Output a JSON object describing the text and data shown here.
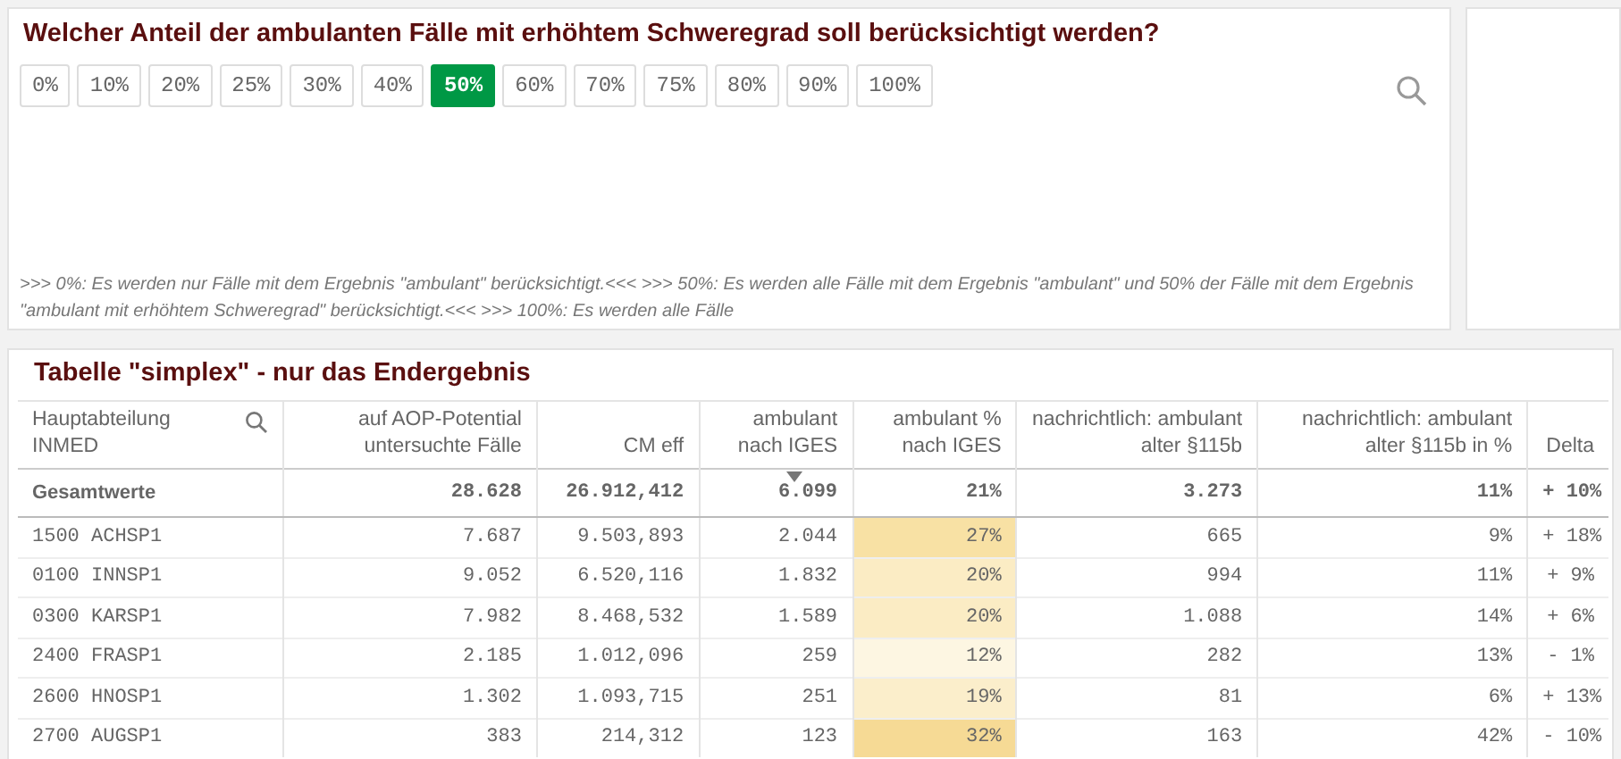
{
  "filter": {
    "title": "Welcher Anteil der ambulanten Fälle mit erhöhtem Schweregrad soll berücksichtigt werden?",
    "options": [
      {
        "label": "0%",
        "selected": false
      },
      {
        "label": "10%",
        "selected": false
      },
      {
        "label": "20%",
        "selected": false
      },
      {
        "label": "25%",
        "selected": false
      },
      {
        "label": "30%",
        "selected": false
      },
      {
        "label": "40%",
        "selected": false
      },
      {
        "label": "50%",
        "selected": true
      },
      {
        "label": "60%",
        "selected": false
      },
      {
        "label": "70%",
        "selected": false
      },
      {
        "label": "75%",
        "selected": false
      },
      {
        "label": "80%",
        "selected": false
      },
      {
        "label": "90%",
        "selected": false
      },
      {
        "label": "100%",
        "selected": false
      }
    ],
    "note": ">>> 0%: Es werden nur Fälle mit dem Ergebnis \"ambulant\" berücksichtigt.<<< >>> 50%: Es werden alle Fälle mit dem Ergebnis \"ambulant\" und 50% der Fälle mit dem Ergebnis \"ambulant mit erhöhtem Schweregrad\" berücksichtigt.<<< >>> 100%: Es werden alle Fälle"
  },
  "table": {
    "title": "Tabelle \"simplex\" - nur das Endergebnis",
    "columns": [
      "Hauptabteilung INMED",
      "auf AOP-Potential untersuchte Fälle",
      "CM eff",
      "ambulant nach IGES",
      "ambulant % nach IGES",
      "nachrichtlich: ambulant alter §115b",
      "nachrichtlich: ambulant alter §115b in %",
      "Delta"
    ],
    "totals": [
      "Gesamtwerte",
      "28.628",
      "26.912,412",
      "6.099",
      "21%",
      "3.273",
      "11%",
      "+ 10%"
    ],
    "rows": [
      {
        "cells": [
          "1500 ACHSP1",
          "7.687",
          "9.503,893",
          "2.044",
          "27%",
          "665",
          "9%",
          "+ 18%"
        ],
        "color": "#f8e1a4"
      },
      {
        "cells": [
          "0100 INNSP1",
          "9.052",
          "6.520,116",
          "1.832",
          "20%",
          "994",
          "11%",
          "+ 9%"
        ],
        "color": "#fbecc4"
      },
      {
        "cells": [
          "0300 KARSP1",
          "7.982",
          "8.468,532",
          "1.589",
          "20%",
          "1.088",
          "14%",
          "+ 6%"
        ],
        "color": "#fbecc4"
      },
      {
        "cells": [
          "2400 FRASP1",
          "2.185",
          "1.012,096",
          "259",
          "12%",
          "282",
          "13%",
          "- 1%"
        ],
        "color": "#fdf6e2"
      },
      {
        "cells": [
          "2600 HNOSP1",
          "1.302",
          "1.093,715",
          "251",
          "19%",
          "81",
          "6%",
          "+ 13%"
        ],
        "color": "#fbeecb"
      },
      {
        "cells": [
          "2700 AUGSP1",
          "383",
          "214,312",
          "123",
          "32%",
          "163",
          "42%",
          "- 10%"
        ],
        "color": "#f6da95"
      }
    ]
  }
}
